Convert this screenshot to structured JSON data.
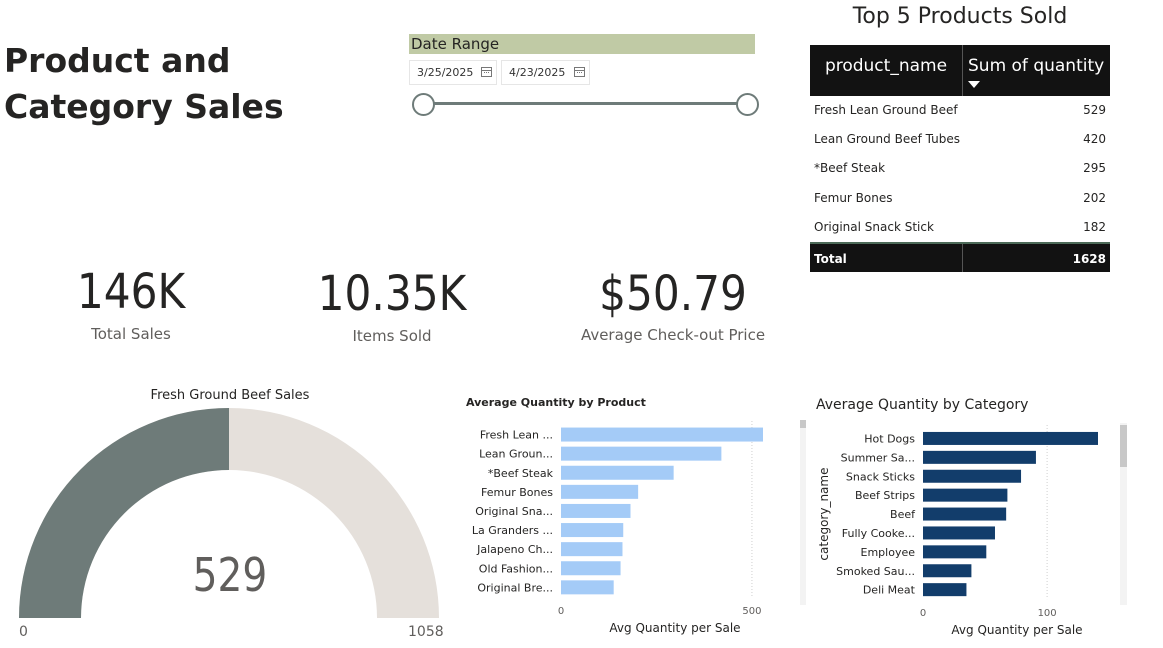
{
  "page": {
    "title_line1": "Product and",
    "title_line2": "Category Sales"
  },
  "date_slicer": {
    "header": "Date Range",
    "start_date": "3/25/2025",
    "end_date": "4/23/2025",
    "start_icon": "calendar-icon",
    "end_icon": "calendar-icon"
  },
  "top_products_table": {
    "title": "Top 5 Products Sold",
    "col_name": "product_name",
    "col_qty": "Sum of quantity",
    "rows": [
      {
        "name": "Fresh Lean Ground Beef",
        "qty": "529"
      },
      {
        "name": "Lean Ground Beef Tubes",
        "qty": "420"
      },
      {
        "name": "*Beef Steak",
        "qty": "295"
      },
      {
        "name": "Femur Bones",
        "qty": "202"
      },
      {
        "name": "Original Snack Stick",
        "qty": "182"
      }
    ],
    "total_label": "Total",
    "total_value": "1628"
  },
  "kpis": {
    "total_sales": {
      "value": "146K",
      "label": "Total Sales"
    },
    "items_sold": {
      "value": "10.35K",
      "label": "Items Sold"
    },
    "avg_checkout": {
      "value": "$50.79",
      "label": "Average Check-out Price"
    }
  },
  "gauge": {
    "title": "Fresh Ground Beef Sales",
    "value_label": "529",
    "min_label": "0",
    "max_label": "1058",
    "value": 529,
    "min": 0,
    "max": 1058,
    "fill_color": "#6e7b79",
    "track_color": "#e5e0db"
  },
  "chart_data": [
    {
      "type": "bar",
      "orientation": "horizontal",
      "title": "Average Quantity by Product",
      "xlabel": "Avg Quantity per Sale",
      "ylabel": "",
      "categories": [
        "Fresh Lean ...",
        "Lean Groun...",
        "*Beef Steak",
        "Femur Bones",
        "Original Sna...",
        "La Granders ...",
        "Jalapeno Ch...",
        "Old Fashion...",
        "Original Bre..."
      ],
      "values": [
        529,
        420,
        295,
        202,
        182,
        163,
        161,
        156,
        138
      ],
      "xlim": [
        0,
        529
      ],
      "xticks": [
        "0",
        "500"
      ],
      "xtick_values": [
        0,
        500
      ],
      "color": "#a4cbf7"
    },
    {
      "type": "bar",
      "orientation": "horizontal",
      "title": "Average Quantity by Category",
      "xlabel": "Avg Quantity per Sale",
      "ylabel": "category_name",
      "categories": [
        "Hot Dogs",
        "Summer Sa...",
        "Snack Sticks",
        "Beef Strips",
        "Beef",
        "Fully Cooke...",
        "Employee",
        "Smoked Sau...",
        "Deli Meat"
      ],
      "values": [
        141,
        91,
        79,
        68,
        67,
        58,
        51,
        39,
        35
      ],
      "xlim": [
        0,
        141
      ],
      "xticks": [
        "0",
        "100"
      ],
      "xtick_values": [
        0,
        100
      ],
      "color": "#123d6b"
    }
  ]
}
